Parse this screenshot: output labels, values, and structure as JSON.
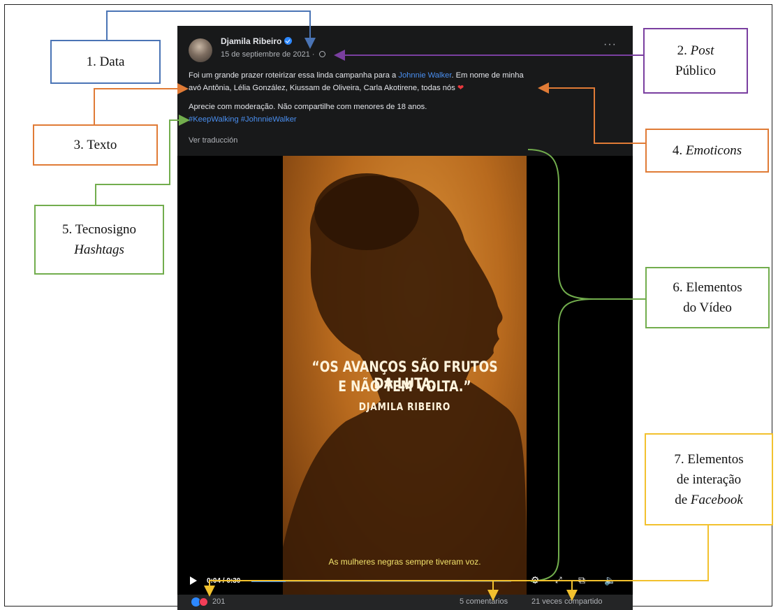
{
  "post": {
    "author": "Djamila Ribeiro",
    "date": "15 de septiembre de 2021 · ",
    "more": "···",
    "text_a": "Foi um grande prazer roteirizar essa linda campanha para a ",
    "text_link": "Johnnie Walker",
    "text_b": ". Em nome de minha",
    "text_line2": "avó Antônia, Lélia González, Kiussam de Oliveira, Carla Akotirene, todas nós ",
    "heart": "❤",
    "text_line3": "Aprecie com moderação. Não compartilhe com menores de 18 anos.",
    "hashtags": "#KeepWalking #JohnnieWalker",
    "translate": "Ver traducción"
  },
  "video": {
    "quote_line1": "“OS AVANÇOS SÃO FRUTOS DA LUTA.",
    "quote_line2": "E NÃO TEM VOLTA.”",
    "quote_author": "DJAMILA RIBEIRO",
    "subtitle": "As mulheres negras sempre tiveram voz.",
    "time": "0:04 / 0:30",
    "progress_fraction": 0.133
  },
  "reactions": {
    "count": "201",
    "comments": "5 comentarios",
    "shares": "21 veces compartido"
  },
  "annotations": {
    "data": "1. Data",
    "post_num": "2. ",
    "post_em": "Post",
    "post_line2": "Público",
    "texto": "3. Texto",
    "emoticons_num": "4. ",
    "emoticons_em": "Emoticons",
    "hashtags_line1": "5. Tecnosigno",
    "hashtags_em": "Hashtags",
    "video_line1": "6. Elementos",
    "video_line2": "do Vídeo",
    "fb_line1": "7. Elementos",
    "fb_line2": "de interação",
    "fb_line3_pre": "de ",
    "fb_line3_em": "Facebook"
  },
  "colors": {
    "blue": "#4a74b5",
    "purple": "#7a3fa0",
    "orange": "#e07b36",
    "green": "#72ad4d",
    "yellow": "#f2c12e",
    "facebook_link": "#4a8ff0"
  }
}
